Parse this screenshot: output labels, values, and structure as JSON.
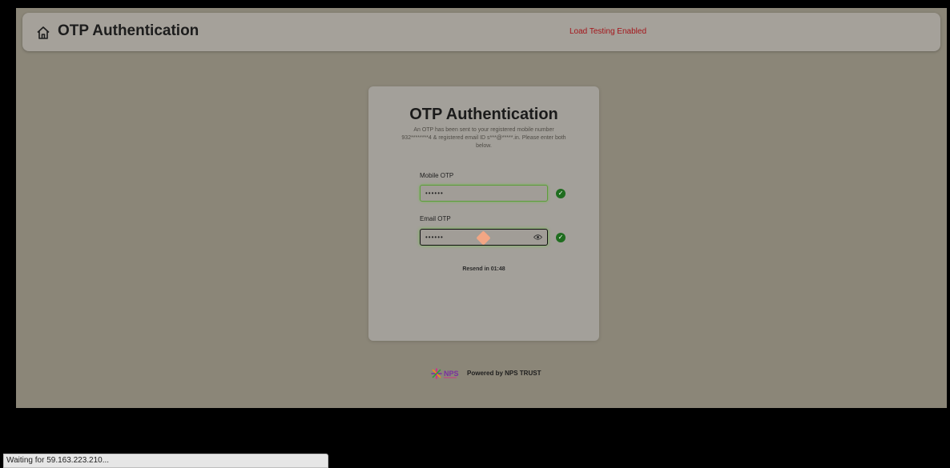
{
  "header": {
    "title": "OTP Authentication",
    "load_testing": "Load Testing Enabled",
    "home_icon": "home-icon"
  },
  "card": {
    "title": "OTP Authentication",
    "subtitle": "An OTP has been sent to your registered mobile number 932********4 & registered email ID s***@*****.in. Please enter both below.",
    "mobile_label": "Mobile OTP",
    "mobile_value": "••••••",
    "email_label": "Email OTP",
    "email_value": "••••••",
    "resend": "Resend in 01:48",
    "check_icon": "check-circle-icon",
    "eye_icon": "eye-icon"
  },
  "footer": {
    "logo_text": "NPS",
    "powered_by": "Powered by NPS TRUST"
  },
  "status_bar": {
    "text": "Waiting for 59.163.223.210..."
  },
  "colors": {
    "success": "#1f6d1f",
    "alert": "#a4151a"
  }
}
